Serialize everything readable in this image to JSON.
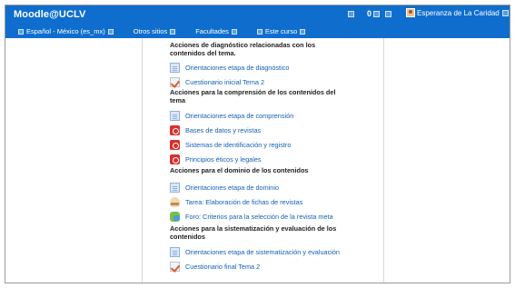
{
  "header": {
    "brand": "Moodle@UCLV",
    "message_count": "0",
    "user_name": "Esperanza de La Caridad"
  },
  "menu": {
    "language": "Español - México (es_mx)",
    "other_sites": "Otros sitios",
    "faculties": "Facultades",
    "this_course": "Este curso"
  },
  "sections": [
    {
      "heading": "Acciones de diagnóstico relacionadas con los contenidos del tema.",
      "activities": [
        {
          "label": "Orientaciones etapa de diagnóstico",
          "icon": "page-icon"
        },
        {
          "label": "Cuestionario inicial Tema 2",
          "icon": "quiz-icon"
        }
      ]
    },
    {
      "heading": "Acciones para la comprensión de los contenidos del tema",
      "activities": [
        {
          "label": "Orientaciones etapa de comprensión",
          "icon": "page-icon"
        },
        {
          "label": "Bases de datos y revistas",
          "icon": "pdf-icon"
        },
        {
          "label": "Sistemas de identificación y registro",
          "icon": "pdf-icon"
        },
        {
          "label": "Principios éticos y legales",
          "icon": "pdf-icon"
        }
      ]
    },
    {
      "heading": "Acciones para el dominio de los contenidos",
      "activities": [
        {
          "label": "Orientaciones etapa de dominio",
          "icon": "page-icon"
        },
        {
          "label": "Tarea: Elaboración de fichas de revistas",
          "icon": "assignment-icon"
        },
        {
          "label": "Foro: Criterios para la selección de la revista meta",
          "icon": "forum-icon"
        }
      ]
    },
    {
      "heading": "Acciones para la sistematización y evaluación de los contenidos",
      "activities": [
        {
          "label": "Orientaciones etapa de sistematización y evaluación",
          "icon": "page-icon"
        },
        {
          "label": "Cuestionario final Tema 2",
          "icon": "quiz-icon"
        }
      ]
    }
  ],
  "colors": {
    "navbar": "#0f6ecd",
    "link": "#1260b5"
  }
}
